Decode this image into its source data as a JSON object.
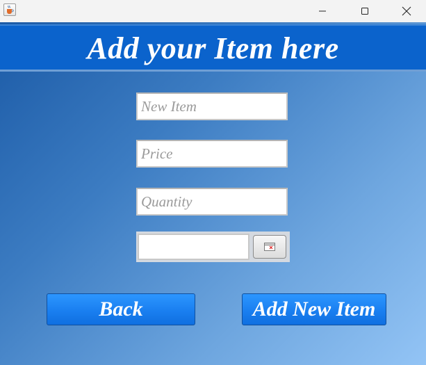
{
  "window": {
    "title": "",
    "icon": "java-cup-icon",
    "controls": [
      "minimize-icon",
      "maximize-icon",
      "close-icon"
    ]
  },
  "header": {
    "title": "Add your Item here",
    "color": "#0b63cc"
  },
  "form": {
    "item_placeholder": "New Item",
    "price_placeholder": "Price",
    "quantity_placeholder": "Quantity",
    "date_value": "",
    "date_picker_icon": "calendar-icon"
  },
  "buttons": {
    "back_label": "Back",
    "add_label": "Add New Item",
    "color": "#1a7ff0"
  }
}
